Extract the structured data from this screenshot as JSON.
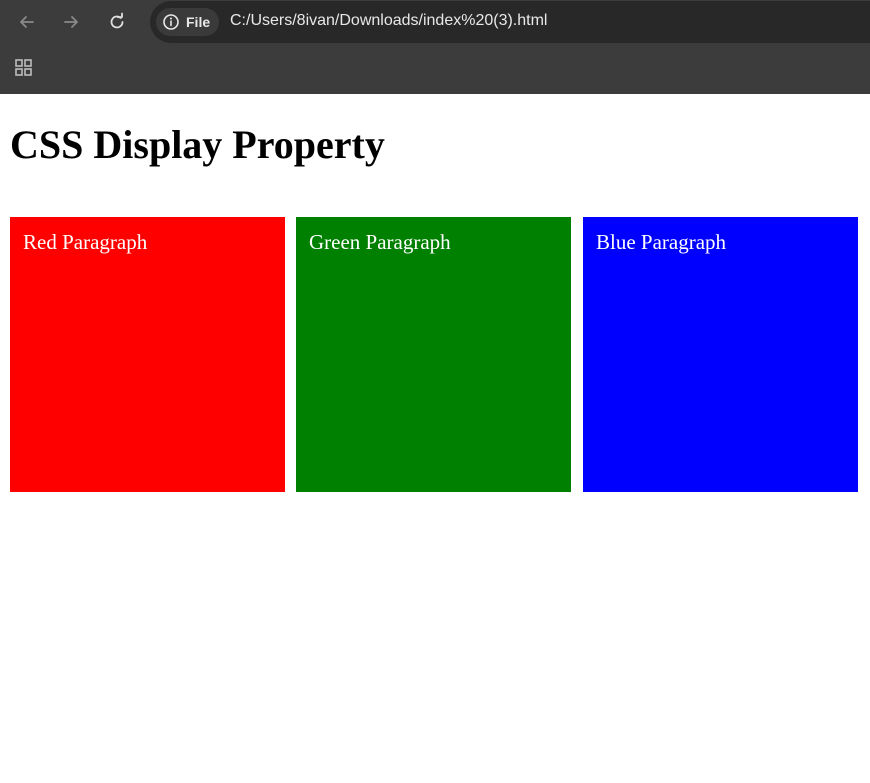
{
  "browser": {
    "site_chip_label": "File",
    "url": "C:/Users/8ivan/Downloads/index%20(3).html",
    "icons": [
      "back-icon",
      "forward-icon",
      "reload-icon",
      "info-icon",
      "apps-grid-icon"
    ]
  },
  "page": {
    "title": "CSS Display Property",
    "boxes": [
      {
        "label": "Red Paragraph",
        "color": "#ff0000"
      },
      {
        "label": "Green Paragraph",
        "color": "#008000"
      },
      {
        "label": "Blue Paragraph",
        "color": "#0000ff"
      }
    ]
  }
}
